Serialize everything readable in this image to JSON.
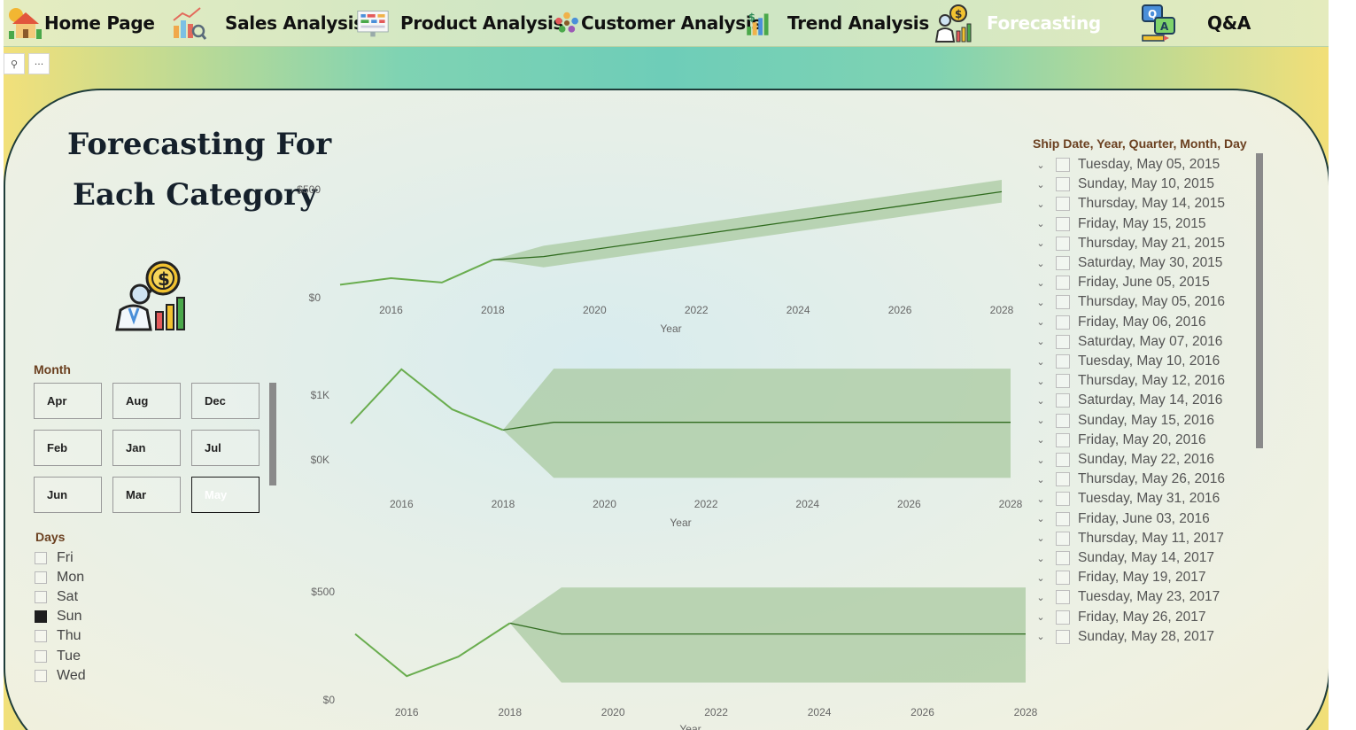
{
  "nav": {
    "items": [
      {
        "label": "Home Page",
        "icon": "house-icon"
      },
      {
        "label": "Sales Analysis",
        "icon": "bar-chart-magnifier-icon"
      },
      {
        "label": "Product Analysis",
        "icon": "dashboard-board-icon"
      },
      {
        "label": "Customer Analysis",
        "icon": "people-group-icon"
      },
      {
        "label": "Trend Analysis",
        "icon": "money-chart-icon"
      },
      {
        "label": "Forecasting",
        "icon": "analyst-icon",
        "active": true
      },
      {
        "label": "Q&A",
        "icon": "qa-chat-icon"
      }
    ],
    "active_color": "#ffffff"
  },
  "toolbar": {
    "pin_icon": "pin-icon",
    "more_icon": "ellipsis-icon",
    "more_glyph": "···",
    "pin_glyph": "⚲"
  },
  "page": {
    "title_line1": "Forecasting For",
    "title_line2": "Each Category",
    "illustration_icon": "analyst-magnifier-dollar-icon"
  },
  "month_slicer": {
    "label": "Month",
    "options": [
      "Apr",
      "Aug",
      "Dec",
      "Feb",
      "Jan",
      "Jul",
      "Jun",
      "Mar",
      "May"
    ],
    "selected": "May"
  },
  "days_slicer": {
    "label": "Days",
    "options": [
      {
        "label": "Fri",
        "checked": false
      },
      {
        "label": "Mon",
        "checked": false
      },
      {
        "label": "Sat",
        "checked": false
      },
      {
        "label": "Sun",
        "checked": true
      },
      {
        "label": "Thu",
        "checked": false
      },
      {
        "label": "Tue",
        "checked": false
      },
      {
        "label": "Wed",
        "checked": false
      }
    ]
  },
  "date_slicer": {
    "label": "Ship Date, Year, Quarter, Month, Day",
    "items": [
      "Tuesday, May 05, 2015",
      "Sunday, May 10, 2015",
      "Thursday, May 14, 2015",
      "Friday, May 15, 2015",
      "Thursday, May 21, 2015",
      "Saturday, May 30, 2015",
      "Friday, June 05, 2015",
      "Thursday, May 05, 2016",
      "Friday, May 06, 2016",
      "Saturday, May 07, 2016",
      "Tuesday, May 10, 2016",
      "Thursday, May 12, 2016",
      "Saturday, May 14, 2016",
      "Sunday, May 15, 2016",
      "Friday, May 20, 2016",
      "Sunday, May 22, 2016",
      "Thursday, May 26, 2016",
      "Tuesday, May 31, 2016",
      "Friday, June 03, 2016",
      "Thursday, May 11, 2017",
      "Sunday, May 14, 2017",
      "Friday, May 19, 2017",
      "Tuesday, May 23, 2017",
      "Friday, May 26, 2017",
      "Sunday, May 28, 2017"
    ]
  },
  "colors": {
    "line": "#6aad4f",
    "forecast_line": "#2f6b1e",
    "band": "#a9c9a0",
    "axis_text": "#666666"
  },
  "chart_data": [
    {
      "type": "line",
      "xlabel": "Year",
      "x_ticks": [
        2016,
        2018,
        2020,
        2022,
        2024,
        2026,
        2028
      ],
      "y_ticks": [
        "$0",
        "$500"
      ],
      "ylim": [
        0,
        500
      ],
      "xlim": [
        2015,
        2028
      ],
      "actual": {
        "x": [
          2015,
          2016,
          2017,
          2018
        ],
        "y": [
          60,
          90,
          70,
          175
        ]
      },
      "forecast": {
        "x": [
          2018,
          2019,
          2028
        ],
        "y": [
          175,
          190,
          490
        ]
      },
      "band_upper": {
        "x": [
          2018,
          2019,
          2028
        ],
        "y": [
          175,
          240,
          545
        ]
      },
      "band_lower": {
        "x": [
          2018,
          2019,
          2028
        ],
        "y": [
          175,
          140,
          440
        ]
      }
    },
    {
      "type": "line",
      "xlabel": "Year",
      "x_ticks": [
        2016,
        2018,
        2020,
        2022,
        2024,
        2026,
        2028
      ],
      "y_ticks": [
        "$0K",
        "$1K"
      ],
      "ylim": [
        0,
        1000
      ],
      "xlim": [
        2015,
        2028
      ],
      "actual": {
        "x": [
          2015,
          2016,
          2017,
          2018
        ],
        "y": [
          560,
          1400,
          780,
          460
        ]
      },
      "forecast": {
        "x": [
          2018,
          2019,
          2028
        ],
        "y": [
          460,
          580,
          580
        ]
      },
      "band_upper": {
        "x": [
          2018,
          2019,
          2028
        ],
        "y": [
          460,
          1410,
          1410
        ]
      },
      "band_lower": {
        "x": [
          2018,
          2019,
          2028
        ],
        "y": [
          460,
          -280,
          -280
        ]
      }
    },
    {
      "type": "line",
      "xlabel": "Year",
      "x_ticks": [
        2016,
        2018,
        2020,
        2022,
        2024,
        2026,
        2028
      ],
      "y_ticks": [
        "$0",
        "$500"
      ],
      "ylim": [
        0,
        500
      ],
      "xlim": [
        2015,
        2028
      ],
      "actual": {
        "x": [
          2015,
          2016,
          2017,
          2018
        ],
        "y": [
          305,
          110,
          200,
          355
        ]
      },
      "forecast": {
        "x": [
          2018,
          2019,
          2028
        ],
        "y": [
          355,
          305,
          305
        ]
      },
      "band_upper": {
        "x": [
          2018,
          2019,
          2028
        ],
        "y": [
          355,
          520,
          520
        ]
      },
      "band_lower": {
        "x": [
          2018,
          2019,
          2028
        ],
        "y": [
          355,
          80,
          80
        ]
      }
    }
  ]
}
